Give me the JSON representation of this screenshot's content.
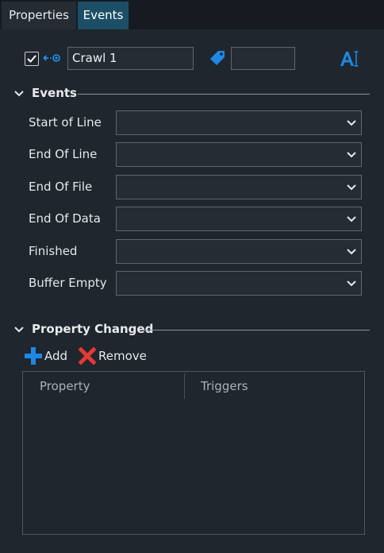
{
  "tabs": [
    {
      "label": "Properties",
      "active": false
    },
    {
      "label": "Events",
      "active": true
    }
  ],
  "header": {
    "enabled": true,
    "name_value": "Crawl 1",
    "tag_value": "",
    "icons": [
      "link-icon",
      "tag-icon",
      "text-style-icon"
    ]
  },
  "events_section": {
    "title": "Events",
    "rows": [
      {
        "label": "Start of Line",
        "value": ""
      },
      {
        "label": "End Of Line",
        "value": ""
      },
      {
        "label": "End Of File",
        "value": ""
      },
      {
        "label": "End Of Data",
        "value": ""
      },
      {
        "label": "Finished",
        "value": ""
      },
      {
        "label": "Buffer Empty",
        "value": ""
      }
    ]
  },
  "property_section": {
    "title": "Property Changed",
    "add_label": "Add",
    "remove_label": "Remove",
    "columns": [
      "Property",
      "Triggers"
    ],
    "rows": []
  },
  "colors": {
    "background": "#1f262d",
    "tab_active": "#1c4f66",
    "accent_blue": "#1e88e5",
    "remove_red": "#e53935"
  }
}
